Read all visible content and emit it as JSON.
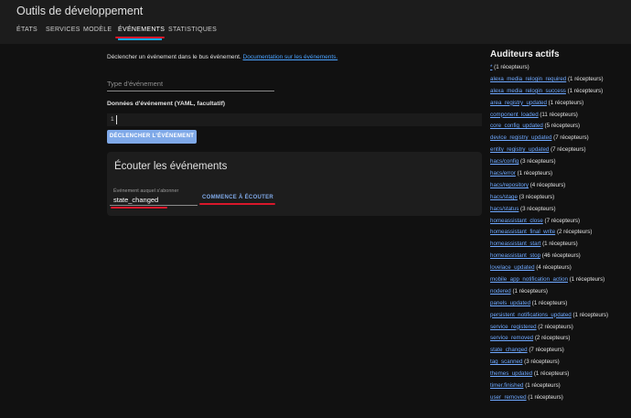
{
  "header": {
    "title": "Outils de développement",
    "tabs": [
      {
        "label": "ÉTATS"
      },
      {
        "label": "SERVICES"
      },
      {
        "label": "MODÈLE"
      },
      {
        "label": "ÉVÉNEMENTS"
      },
      {
        "label": "STATISTIQUES"
      }
    ],
    "active_tab": "ÉVÉNEMENTS"
  },
  "fire": {
    "description": "Déclencher un événement dans le bus événement.",
    "doc_link": "Documentation sur les événements.",
    "type_placeholder": "Type d'événement",
    "data_label": "Données d'événement (YAML, facultatif)",
    "line_number": "1",
    "button_label": "DÉCLENCHER L'ÉVÉNEMENT"
  },
  "listen": {
    "title": "Écouter les événements",
    "field_label": "Événement auquel s'abonner",
    "field_value": "state_changed",
    "button_label": "COMMENCE À ÉCOUTER"
  },
  "listeners": {
    "title": "Auditeurs actifs",
    "items": [
      {
        "event": "*",
        "count": "(1 récepteurs)"
      },
      {
        "event": "alexa_media_relogin_required",
        "count": "(1 récepteurs)"
      },
      {
        "event": "alexa_media_relogin_success",
        "count": "(1 récepteurs)"
      },
      {
        "event": "area_registry_updated",
        "count": "(1 récepteurs)"
      },
      {
        "event": "component_loaded",
        "count": "(11 récepteurs)"
      },
      {
        "event": "core_config_updated",
        "count": "(5 récepteurs)"
      },
      {
        "event": "device_registry_updated",
        "count": "(7 récepteurs)"
      },
      {
        "event": "entity_registry_updated",
        "count": "(7 récepteurs)"
      },
      {
        "event": "hacs/config",
        "count": "(3 récepteurs)"
      },
      {
        "event": "hacs/error",
        "count": "(1 récepteurs)"
      },
      {
        "event": "hacs/repository",
        "count": "(4 récepteurs)"
      },
      {
        "event": "hacs/stage",
        "count": "(3 récepteurs)"
      },
      {
        "event": "hacs/status",
        "count": "(3 récepteurs)"
      },
      {
        "event": "homeassistant_close",
        "count": "(7 récepteurs)"
      },
      {
        "event": "homeassistant_final_write",
        "count": "(2 récepteurs)"
      },
      {
        "event": "homeassistant_start",
        "count": "(1 récepteurs)"
      },
      {
        "event": "homeassistant_stop",
        "count": "(46 récepteurs)"
      },
      {
        "event": "lovelace_updated",
        "count": "(4 récepteurs)"
      },
      {
        "event": "mobile_app_notification_action",
        "count": "(1 récepteurs)"
      },
      {
        "event": "nodered",
        "count": "(1 récepteurs)"
      },
      {
        "event": "panels_updated",
        "count": "(1 récepteurs)"
      },
      {
        "event": "persistent_notifications_updated",
        "count": "(1 récepteurs)"
      },
      {
        "event": "service_registered",
        "count": "(2 récepteurs)"
      },
      {
        "event": "service_removed",
        "count": "(2 récepteurs)"
      },
      {
        "event": "state_changed",
        "count": "(7 récepteurs)"
      },
      {
        "event": "tag_scanned",
        "count": "(3 récepteurs)"
      },
      {
        "event": "themes_updated",
        "count": "(1 récepteurs)"
      },
      {
        "event": "timer.finished",
        "count": "(1 récepteurs)"
      },
      {
        "event": "user_removed",
        "count": "(1 récepteurs)"
      }
    ]
  }
}
